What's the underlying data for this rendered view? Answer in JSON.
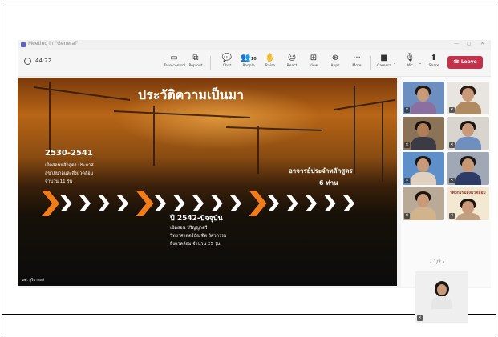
{
  "window": {
    "title": "Meeting in \"General\""
  },
  "toolbar": {
    "timer": "44:22",
    "buttons": [
      {
        "id": "take-control",
        "label": "Take control",
        "icon": "screen-share-icon"
      },
      {
        "id": "pop-out",
        "label": "Pop out",
        "icon": "pop-out-icon"
      },
      {
        "id": "chat",
        "label": "Chat",
        "icon": "chat-icon"
      },
      {
        "id": "people",
        "label": "People",
        "icon": "people-icon",
        "count": "10"
      },
      {
        "id": "raise",
        "label": "Raise",
        "icon": "hand-icon"
      },
      {
        "id": "react",
        "label": "React",
        "icon": "smiley-icon"
      },
      {
        "id": "view",
        "label": "View",
        "icon": "grid-icon"
      },
      {
        "id": "apps",
        "label": "Apps",
        "icon": "plus-box-icon"
      },
      {
        "id": "more",
        "label": "More",
        "icon": "ellipsis-icon"
      },
      {
        "id": "camera",
        "label": "Camera",
        "icon": "camera-icon"
      },
      {
        "id": "mic",
        "label": "Mic",
        "icon": "mic-icon"
      },
      {
        "id": "share",
        "label": "Share",
        "icon": "share-icon"
      }
    ],
    "leave_label": "Leave",
    "leave_color": "#c4314b"
  },
  "slide": {
    "title": "ประวัติความเป็นมา",
    "period1": {
      "years": "2530-2541",
      "lines": [
        "เปิดสอนหลักสูตร ประกาศ",
        "สุขาภิบาลและสิ่งแวดล้อม",
        "จำนวน 11 รุ่น"
      ]
    },
    "teachers": {
      "line1": "อาจารย์ประจำหลักสูตร",
      "line2": "6 ท่าน"
    },
    "period2": {
      "years": "ปี 2542-ปัจจุบัน",
      "lines": [
        "เปิดสอน ปริญญาตรี",
        "วิทยาศาสตร์บัณฑิต วิศวกรรม",
        "สิ่งแวดล้อม จำนวน 25 รุ่น"
      ]
    },
    "footer": "ผศ. สุริยาพงษ์",
    "accent_color": "#f07c1a"
  },
  "gallery": {
    "pager": "1/2",
    "tile_overlay_text": "วิศวกรรมสิ่งแวดล้อม"
  }
}
